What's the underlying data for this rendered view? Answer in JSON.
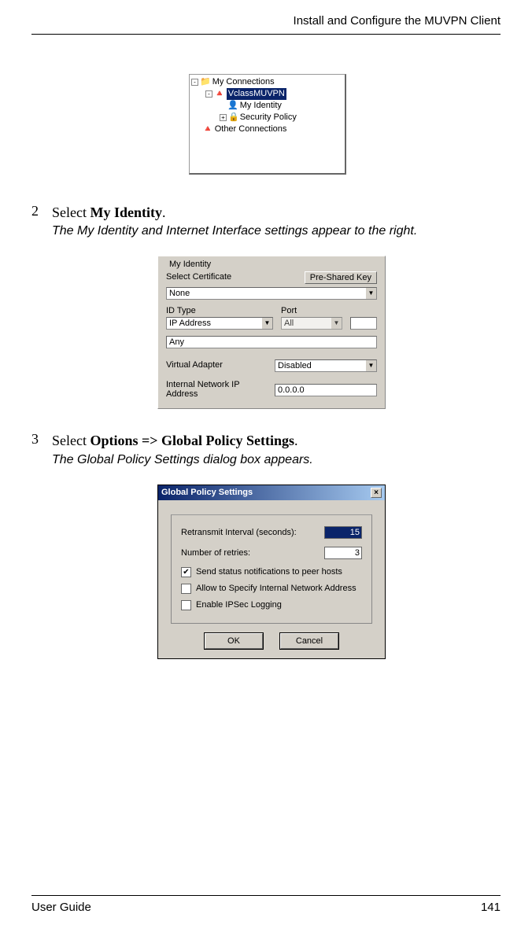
{
  "header": {
    "title": "Install and Configure the MUVPN Client"
  },
  "tree": {
    "root": "My Connections",
    "selected": "VclassMUVPN",
    "children": {
      "identity": "My Identity",
      "security": "Security Policy"
    },
    "other": "Other Connections"
  },
  "step2": {
    "num": "2",
    "text_pre": "Select ",
    "bold": "My Identity",
    "text_post": ".",
    "result": "The My Identity and Internet Interface settings appear to the right."
  },
  "identity": {
    "legend": "My Identity",
    "select_cert_label": "Select Certificate",
    "pre_shared": "Pre-Shared Key",
    "cert_value": "None",
    "id_type_label": "ID Type",
    "id_type_value": "IP Address",
    "port_label": "Port",
    "port_value": "All",
    "any_value": "Any",
    "va_label": "Virtual Adapter",
    "va_value": "Disabled",
    "ip_label": "Internal Network IP Address",
    "ip_value": "0.0.0.0"
  },
  "step3": {
    "num": "3",
    "text_pre": "Select ",
    "bold1": "Options",
    "arrow": " => ",
    "bold2": "Global Policy Settings",
    "text_post": ".",
    "result": "The Global Policy Settings dialog box appears."
  },
  "gp": {
    "title": "Global Policy Settings",
    "retransmit_label": "Retransmit Interval (seconds):",
    "retransmit_value": "15",
    "retries_label": "Number of retries:",
    "retries_value": "3",
    "cb1": "Send status notifications to peer hosts",
    "cb2": "Allow to Specify Internal Network Address",
    "cb3": "Enable IPSec Logging",
    "ok": "OK",
    "cancel": "Cancel"
  },
  "footer": {
    "left": "User Guide",
    "right": "141"
  }
}
